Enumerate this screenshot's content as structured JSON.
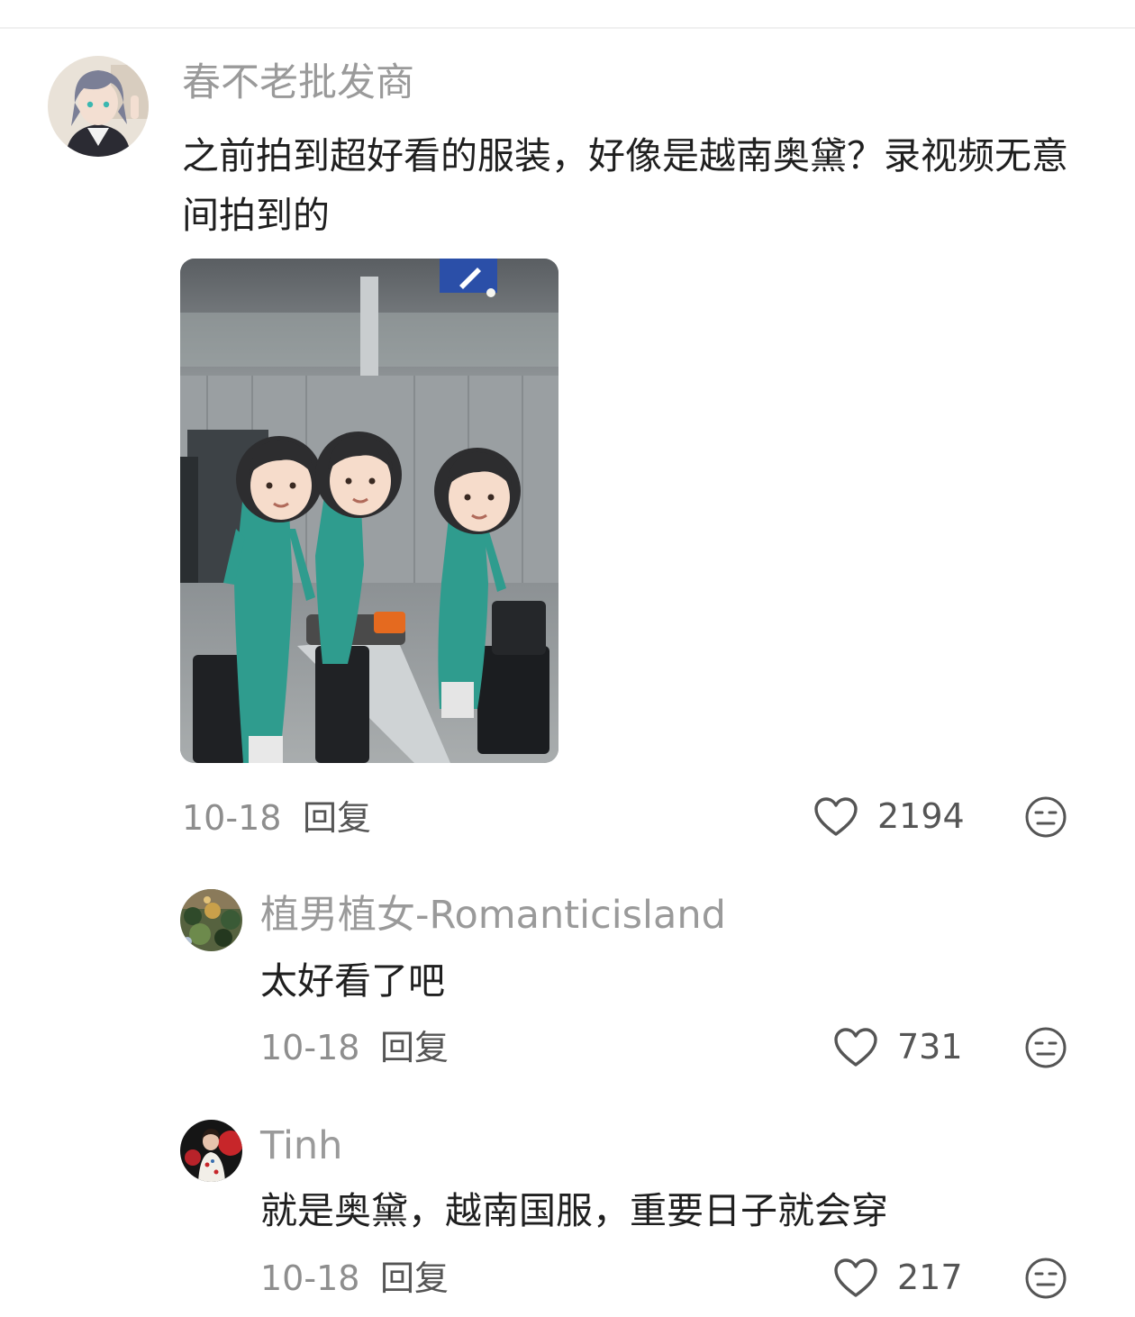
{
  "comments": [
    {
      "username": "春不老批发商",
      "text": "之前拍到超好看的服装，好像是越南奥黛？录视频无意间拍到的",
      "date": "10-18",
      "reply_label": "回复",
      "likes": "2194",
      "has_image": true
    },
    {
      "username": "植男植女-Romanticisland",
      "text": "太好看了吧",
      "date": "10-18",
      "reply_label": "回复",
      "likes": "731"
    },
    {
      "username": "Tinh",
      "text": "就是奥黛，越南国服，重要日子就会穿",
      "date": "10-18",
      "reply_label": "回复",
      "likes": "217"
    }
  ],
  "icons": {
    "like": "heart-outline-icon",
    "emoji": "neutral-face-icon",
    "sign": "airport-sign-icon"
  },
  "colors": {
    "username": "#9a9a9a",
    "text": "#1f1f1f",
    "meta": "#8e8e8e",
    "icon": "#555555",
    "dress": "#2f9c8e"
  }
}
